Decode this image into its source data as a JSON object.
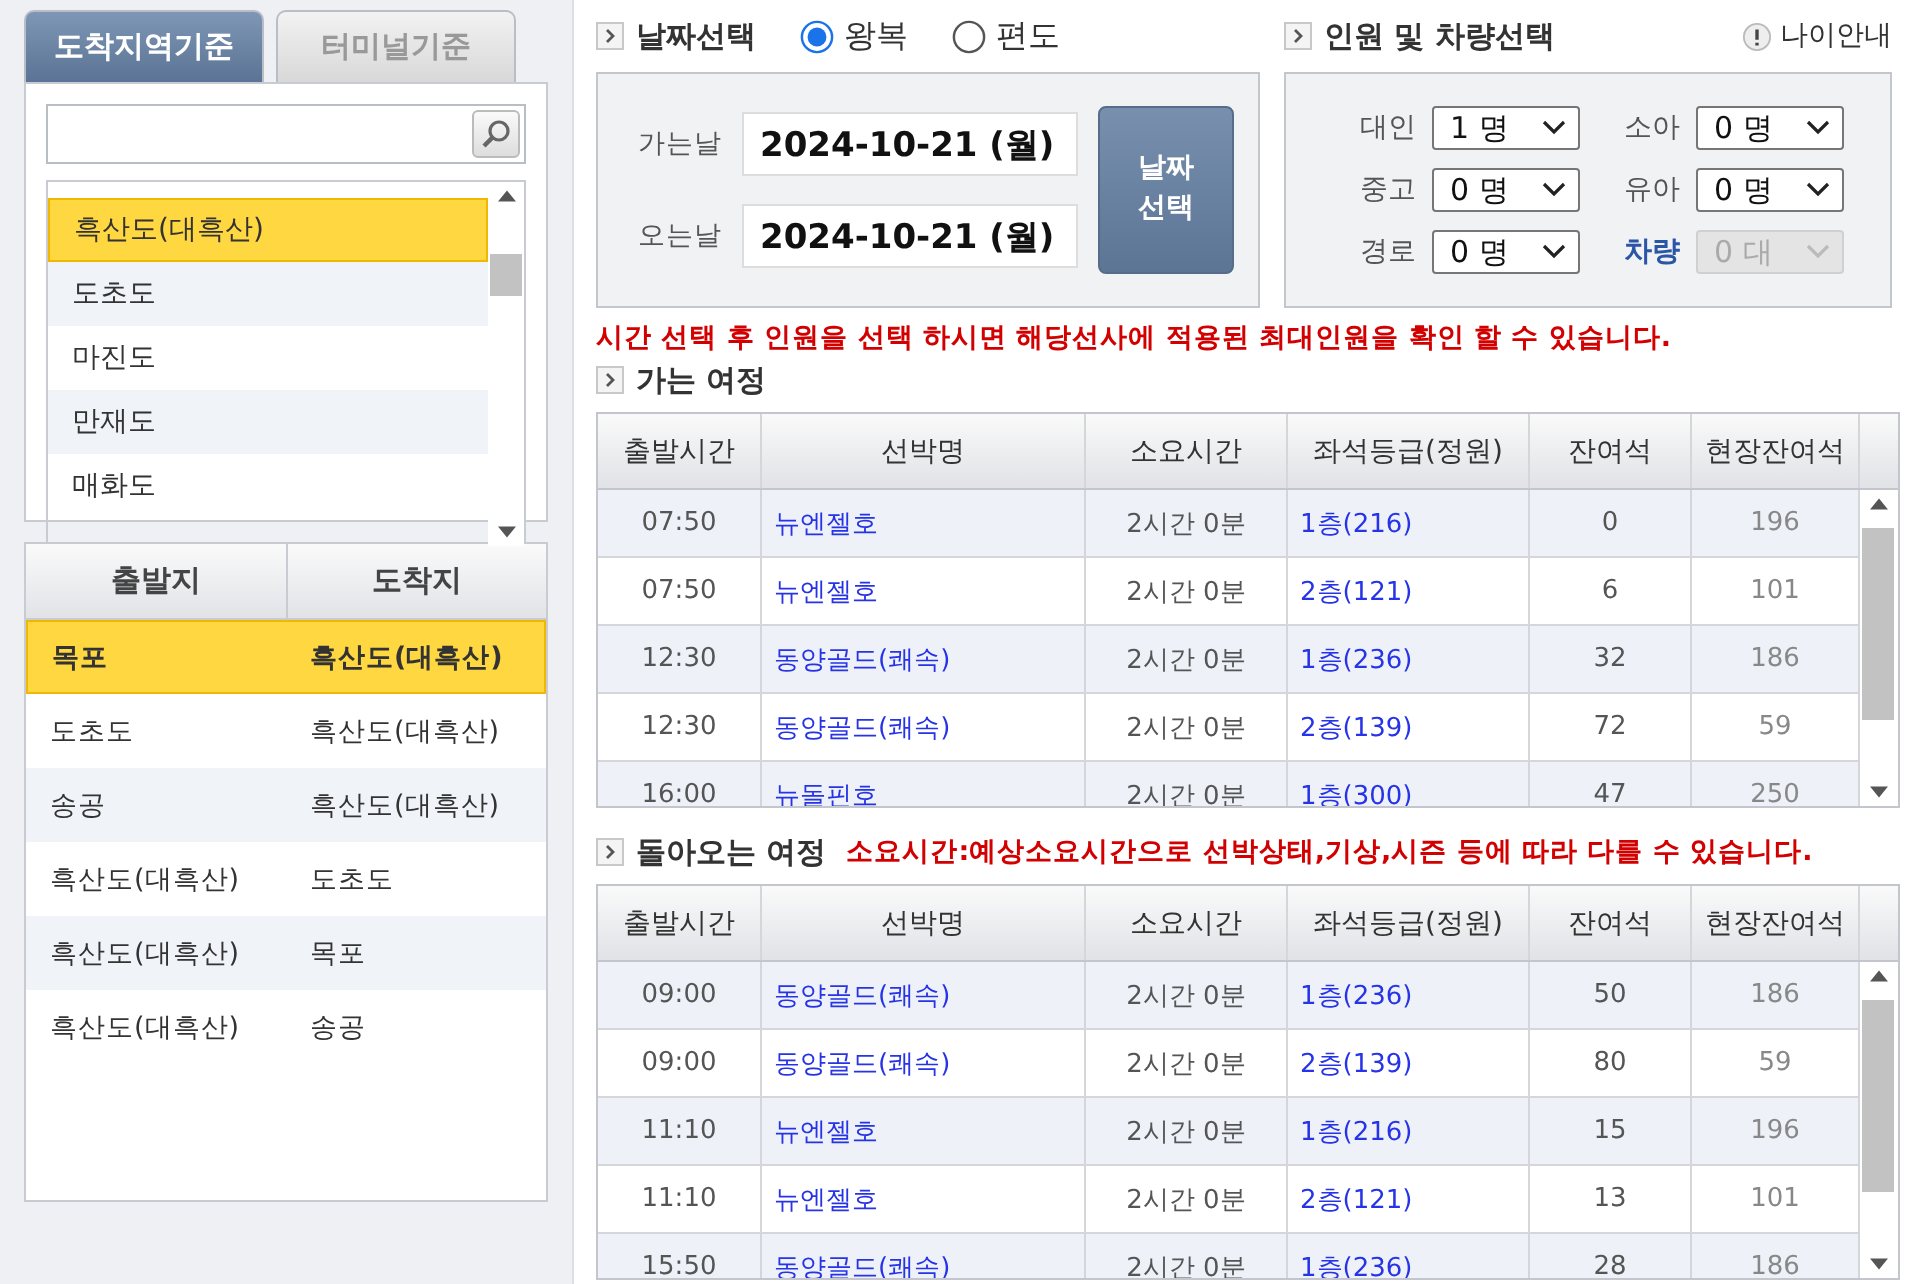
{
  "left": {
    "tabs": [
      {
        "label": "도착지역기준",
        "selected": true
      },
      {
        "label": "터미널기준",
        "selected": false
      }
    ],
    "destinations": [
      {
        "label": "흑산도(대흑산)",
        "selected": true
      },
      {
        "label": "도초도",
        "selected": false
      },
      {
        "label": "마진도",
        "selected": false
      },
      {
        "label": "만재도",
        "selected": false
      },
      {
        "label": "매화도",
        "selected": false
      }
    ],
    "routes": {
      "columns": [
        "출발지",
        "도착지"
      ],
      "rows": [
        {
          "from": "목포",
          "to": "흑산도(대흑산)",
          "selected": true
        },
        {
          "from": "도초도",
          "to": "흑산도(대흑산)",
          "selected": false
        },
        {
          "from": "송공",
          "to": "흑산도(대흑산)",
          "selected": false
        },
        {
          "from": "흑산도(대흑산)",
          "to": "도초도",
          "selected": false
        },
        {
          "from": "흑산도(대흑산)",
          "to": "목포",
          "selected": false
        },
        {
          "from": "흑산도(대흑산)",
          "to": "송공",
          "selected": false
        }
      ]
    }
  },
  "date_section": {
    "title": "날짜선택",
    "trip_types": [
      {
        "label": "왕복",
        "selected": true
      },
      {
        "label": "편도",
        "selected": false
      }
    ],
    "fields": [
      {
        "label": "가는날",
        "value": "2024-10-21 (월)"
      },
      {
        "label": "오는날",
        "value": "2024-10-21 (월)"
      }
    ],
    "button": "날짜 선택"
  },
  "passenger_section": {
    "title": "인원 및 차량선택",
    "info": "나이안내",
    "items": [
      {
        "label": "대인",
        "value": "1 명",
        "kind": "person",
        "disabled": false
      },
      {
        "label": "소아",
        "value": "0 명",
        "kind": "person",
        "disabled": false
      },
      {
        "label": "중고",
        "value": "0 명",
        "kind": "person",
        "disabled": false
      },
      {
        "label": "유아",
        "value": "0 명",
        "kind": "person",
        "disabled": false
      },
      {
        "label": "경로",
        "value": "0 명",
        "kind": "person",
        "disabled": false
      },
      {
        "label": "차량",
        "value": "0 대",
        "kind": "vehicle",
        "disabled": true
      }
    ]
  },
  "notice": "시간 선택 후 인원을 선택 하시면 해당선사에 적용된 최대인원을 확인 할 수 있습니다.",
  "outbound": {
    "title": "가는 여정",
    "columns": [
      "출발시간",
      "선박명",
      "소요시간",
      "좌석등급(정원)",
      "잔여석",
      "현장잔여석"
    ],
    "rows": [
      [
        "07:50",
        "뉴엔젤호",
        "2시간 0분",
        "1층(216)",
        "0",
        "196"
      ],
      [
        "07:50",
        "뉴엔젤호",
        "2시간 0분",
        "2층(121)",
        "6",
        "101"
      ],
      [
        "12:30",
        "동양골드(쾌속)",
        "2시간 0분",
        "1층(236)",
        "32",
        "186"
      ],
      [
        "12:30",
        "동양골드(쾌속)",
        "2시간 0분",
        "2층(139)",
        "72",
        "59"
      ],
      [
        "16:00",
        "뉴돌핀호",
        "2시간 0분",
        "1층(300)",
        "47",
        "250"
      ]
    ]
  },
  "return": {
    "title": "돌아오는 여정",
    "note": "소요시간:예상소요시간으로 선박상태,기상,시즌 등에 따라 다를 수 있습니다.",
    "columns": [
      "출발시간",
      "선박명",
      "소요시간",
      "좌석등급(정원)",
      "잔여석",
      "현장잔여석"
    ],
    "rows": [
      [
        "09:00",
        "동양골드(쾌속)",
        "2시간 0분",
        "1층(236)",
        "50",
        "186"
      ],
      [
        "09:00",
        "동양골드(쾌속)",
        "2시간 0분",
        "2층(139)",
        "80",
        "59"
      ],
      [
        "11:10",
        "뉴엔젤호",
        "2시간 0분",
        "1층(216)",
        "15",
        "196"
      ],
      [
        "11:10",
        "뉴엔젤호",
        "2시간 0분",
        "2층(121)",
        "13",
        "101"
      ],
      [
        "15:50",
        "동양골드(쾌속)",
        "2시간 0분",
        "1층(236)",
        "28",
        "186"
      ]
    ]
  }
}
